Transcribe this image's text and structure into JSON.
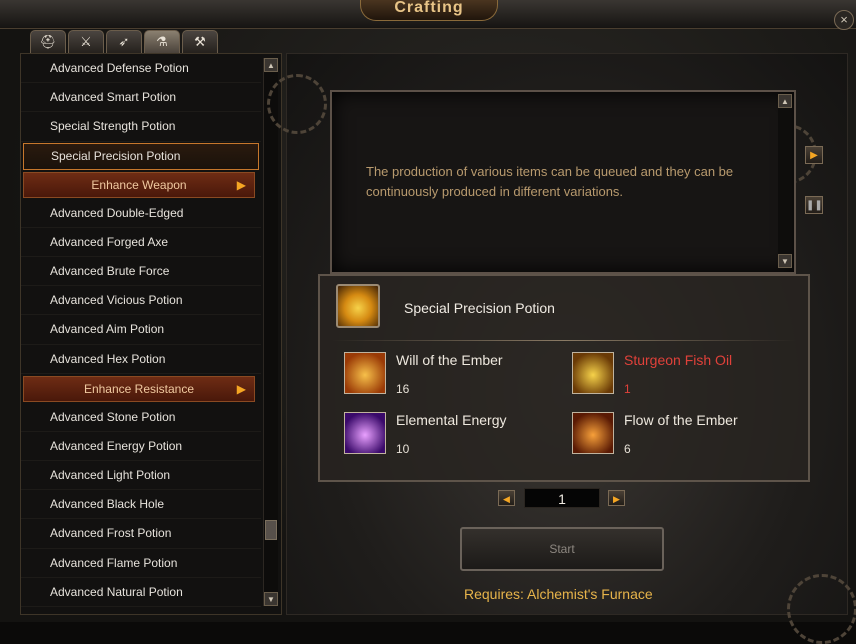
{
  "window": {
    "title": "Crafting",
    "close_icon": "×"
  },
  "tabs": [
    {
      "icon": "helmet-icon",
      "glyph": "⛑",
      "active": false
    },
    {
      "icon": "sword-icon",
      "glyph": "⚔",
      "active": false
    },
    {
      "icon": "bow-icon",
      "glyph": "➶",
      "active": false
    },
    {
      "icon": "potion-flask-icon",
      "glyph": "⚗",
      "active": true
    },
    {
      "icon": "hammer-icon",
      "glyph": "⚒",
      "active": false
    }
  ],
  "recipe_list": {
    "items": [
      {
        "type": "item",
        "label": "Advanced Defense Potion"
      },
      {
        "type": "item",
        "label": "Advanced Smart Potion"
      },
      {
        "type": "item",
        "label": "Special Strength Potion"
      },
      {
        "type": "item",
        "label": "Special Precision Potion",
        "selected": true
      },
      {
        "type": "category",
        "label": "Enhance Weapon"
      },
      {
        "type": "item",
        "label": "Advanced Double-Edged"
      },
      {
        "type": "item",
        "label": "Advanced Forged Axe"
      },
      {
        "type": "item",
        "label": "Advanced Brute Force"
      },
      {
        "type": "item",
        "label": "Advanced Vicious Potion"
      },
      {
        "type": "item",
        "label": "Advanced Aim Potion"
      },
      {
        "type": "item",
        "label": "Advanced Hex Potion"
      },
      {
        "type": "category",
        "label": "Enhance Resistance"
      },
      {
        "type": "item",
        "label": "Advanced Stone Potion"
      },
      {
        "type": "item",
        "label": "Advanced Energy Potion"
      },
      {
        "type": "item",
        "label": "Advanced Light Potion"
      },
      {
        "type": "item",
        "label": "Advanced Black Hole"
      },
      {
        "type": "item",
        "label": "Advanced Frost Potion"
      },
      {
        "type": "item",
        "label": "Advanced Flame Potion"
      },
      {
        "type": "item",
        "label": "Advanced Natural Potion"
      }
    ]
  },
  "queue": {
    "description": "The production of various items can be queued and they can be continuously produced in different variations."
  },
  "recipe": {
    "result_name": "Special Precision Potion",
    "ingredients": [
      {
        "name": "Will of the Ember",
        "count": "16",
        "insufficient": false,
        "icon": "ember-claw-icon",
        "colors": [
          "#f7c04a",
          "#9a3a06"
        ]
      },
      {
        "name": "Sturgeon Fish Oil",
        "count": "1",
        "insufficient": true,
        "icon": "fish-oil-flask-icon",
        "colors": [
          "#f6d24a",
          "#6a3a06"
        ]
      },
      {
        "name": "Elemental Energy",
        "count": "10",
        "insufficient": false,
        "icon": "elemental-energy-icon",
        "colors": [
          "#e9a0ff",
          "#3a0a6a"
        ]
      },
      {
        "name": "Flow of the Ember",
        "count": "6",
        "insufficient": false,
        "icon": "ember-flow-icon",
        "colors": [
          "#f7a03a",
          "#5a1a04"
        ]
      }
    ]
  },
  "quantity": {
    "value": "1"
  },
  "start_label": "Start",
  "requires_text": "Requires: Alchemist's Furnace",
  "colors": {
    "accent": "#f5a623",
    "insufficient": "#e0413a",
    "requires": "#e7b44a"
  }
}
